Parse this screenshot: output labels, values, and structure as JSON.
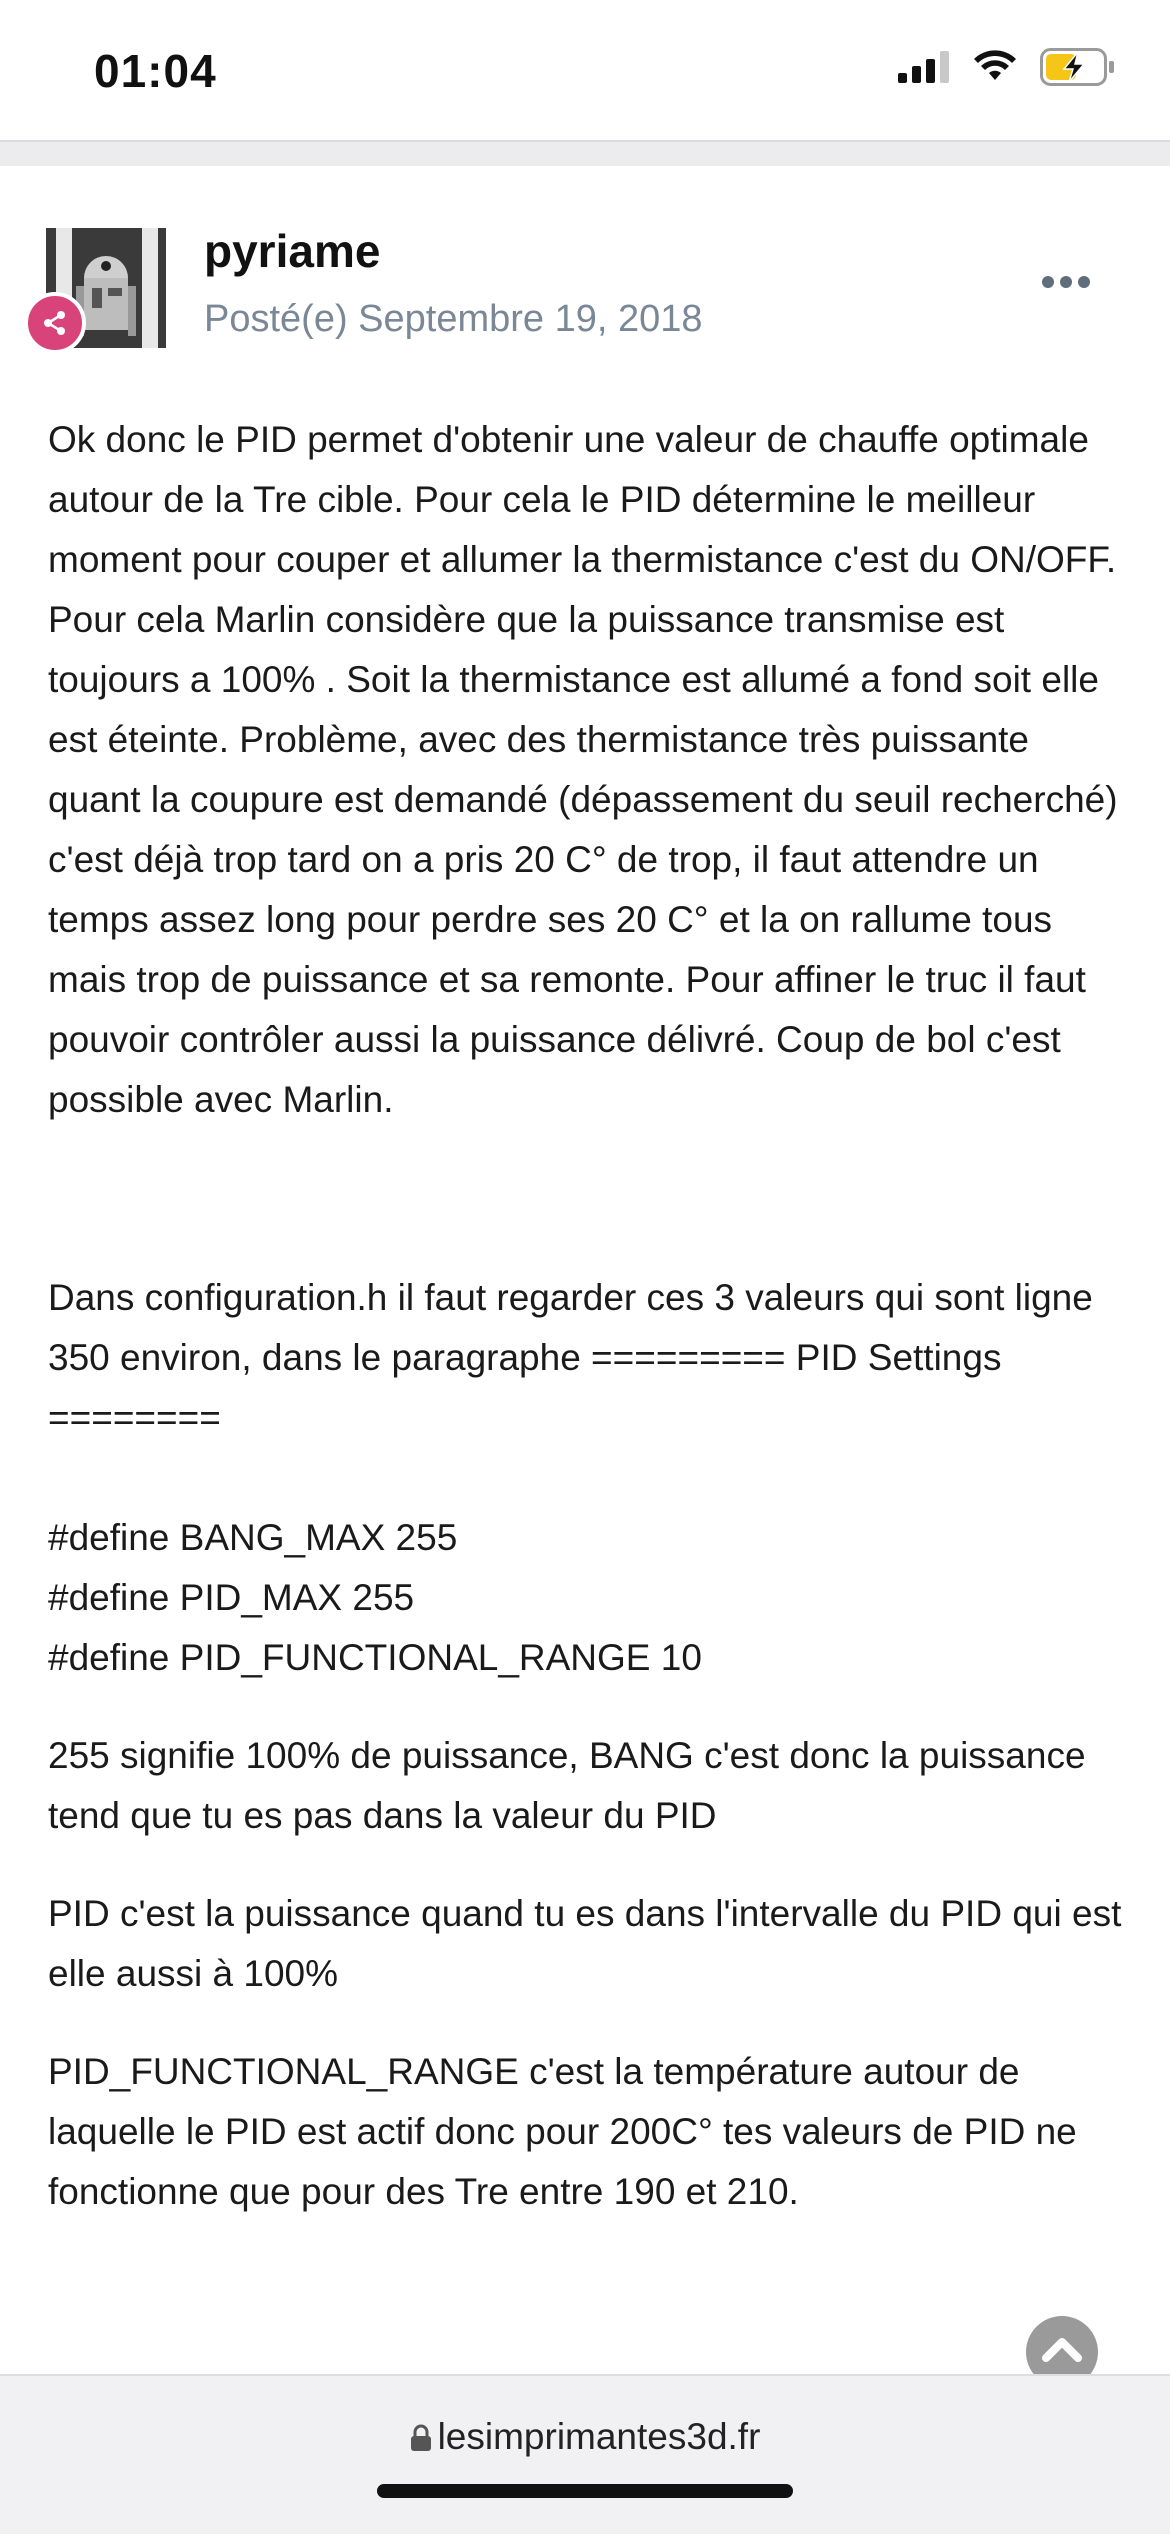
{
  "status_bar": {
    "time": "01:04"
  },
  "post": {
    "author": "pyriame",
    "posted": "Posté(e) Septembre 19, 2018",
    "avatar": "r2d2-avatar",
    "badge_color": "#d8447a",
    "paragraphs": [
      "Ok donc le PID permet d'obtenir une valeur de chauffe optimale autour de la Tre cible. Pour cela le PID détermine le meilleur moment pour couper et allumer la thermistance c'est du ON/OFF. Pour cela Marlin considère que la puissance transmise est toujours a 100% . Soit la thermistance est allumé a fond soit elle est éteinte. Problème, avec des thermistance très puissante quant la coupure est demandé (dépassement du seuil recherché) c'est déjà trop tard on a pris 20 C° de trop, il faut attendre un temps assez long pour perdre ses 20 C° et la on rallume tous mais trop de puissance et sa remonte. Pour affiner le truc il faut pouvoir contrôler aussi la puissance délivré. Coup de bol c'est possible avec Marlin.",
      "Dans configuration.h il faut regarder ces 3 valeurs qui sont ligne 350 environ, dans le paragraphe ========= PID Settings ========",
      "#define BANG_MAX 255",
      "#define PID_MAX 255",
      "#define PID_FUNCTIONAL_RANGE 10",
      "255 signifie 100% de puissance, BANG c'est donc la puissance tend que tu es pas dans la valeur du PID",
      "PID c'est la puissance quand tu es dans l'intervalle du PID qui est elle aussi à 100%",
      "PID_FUNCTIONAL_RANGE c'est la température autour de laquelle le PID est actif donc pour 200C° tes valeurs de PID ne fonctionne que pour des Tre entre 190 et 210."
    ]
  },
  "browser": {
    "url": "lesimprimantes3d.fr"
  }
}
